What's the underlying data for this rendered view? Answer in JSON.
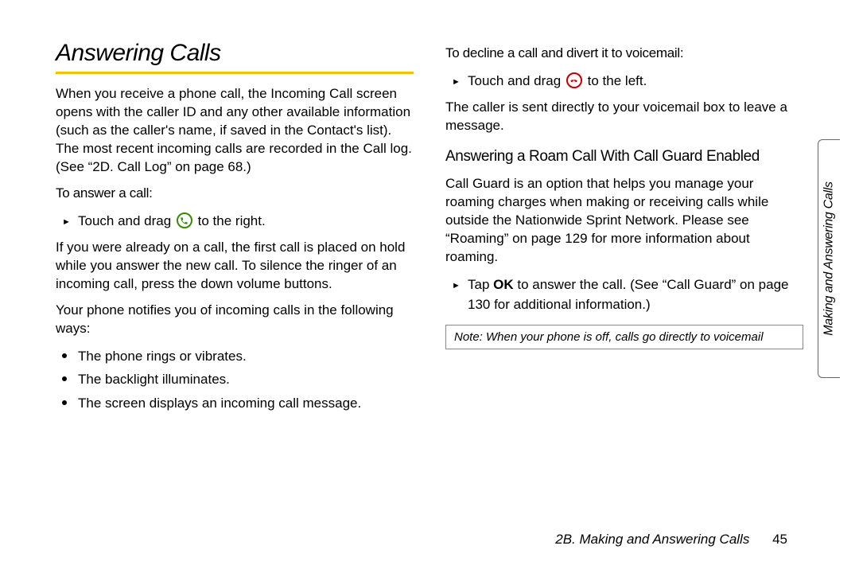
{
  "left": {
    "title": "Answering Calls",
    "intro": "When you receive a phone call, the Incoming Call screen opens with the caller ID and any other available information (such as the caller's name, if saved in the Contact's list). The most recent incoming calls are recorded in the Call log. (See “2D. Call Log” on page 68.)",
    "answer_head": "To answer a call:",
    "answer_pre": "Touch and drag ",
    "answer_post": " to the right.",
    "hold_para": "If you were already on a call, the first call is placed on hold while you answer the new call. To silence the ringer of an incoming call, press the down volume buttons.",
    "notify_para": "Your phone notifies you of incoming calls in the following ways:",
    "dot1": "The phone rings or vibrates.",
    "dot2": "The backlight illuminates.",
    "dot3": "The screen displays an incoming call message."
  },
  "right": {
    "decline_head": "To decline a call and divert it to voicemail:",
    "decline_pre": "Touch and drag ",
    "decline_post": " to the left.",
    "decline_para": "The caller is sent directly to your voicemail box to leave a message.",
    "roam_head": "Answering a Roam Call With Call Guard Enabled",
    "roam_para": "Call Guard is an option that helps you manage your roaming charges when making or receiving calls while outside the Nationwide Sprint Network. Please see “Roaming” on page 129 for more information about roaming.",
    "roam_li_pre": "Tap ",
    "roam_li_bold": "OK",
    "roam_li_post": " to answer the call. (See “Call Guard” on page 130 for additional information.)",
    "note_label": "Note:",
    "note_text": " When your phone is off, calls go directly to voicemail"
  },
  "tab": "Making and Answering Calls",
  "footer_section": "2B. Making and Answering Calls",
  "footer_page": "45"
}
